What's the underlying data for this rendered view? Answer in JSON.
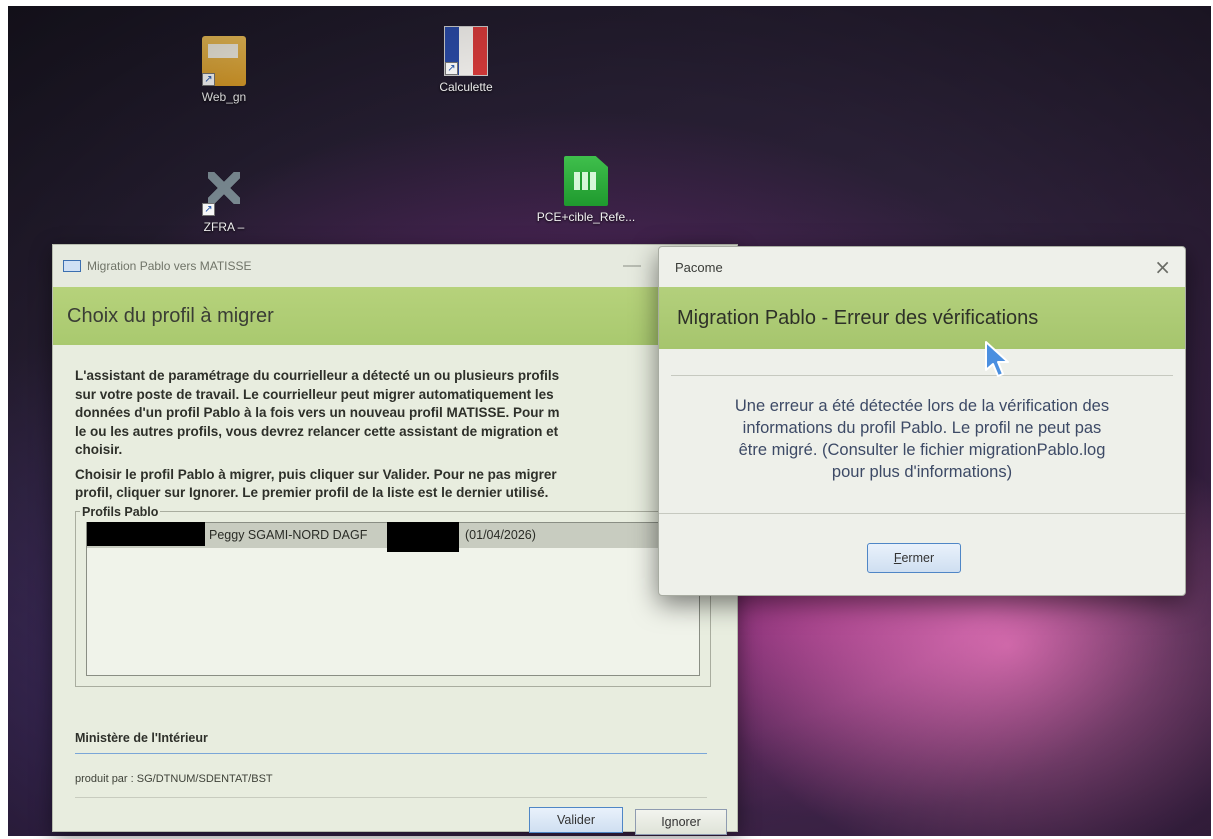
{
  "desktop": {
    "icons": [
      {
        "label": "Web_gn",
        "icon": "folder-icon"
      },
      {
        "label": "Calculette",
        "icon": "calculator-icon"
      },
      {
        "label": "ZFRA –",
        "icon": "network-icon"
      },
      {
        "label": "PCE+cible_Refe...",
        "icon": "spreadsheet-icon"
      }
    ]
  },
  "main_window": {
    "title": "Migration Pablo vers MATISSE",
    "heading": "Choix du profil à migrer",
    "paragraph1_lines": [
      "L'assistant de paramétrage du courrielleur a détecté un ou plusieurs profils",
      "sur votre poste de travail. Le courrielleur peut migrer automatiquement les",
      "données d'un profil Pablo à la fois vers un nouveau profil MATISSE. Pour m",
      "le ou les autres profils, vous devrez relancer cette assistant de migration et",
      "choisir."
    ],
    "paragraph2_lines": [
      "Choisir le profil Pablo à migrer, puis cliquer sur Valider. Pour ne pas migrer",
      "profil, cliquer sur Ignorer. Le premier profil de la liste est le dernier utilisé."
    ],
    "group_label": "Profils Pablo",
    "profiles": [
      {
        "name": "Peggy SGAMI-NORD DAGF",
        "date": "(01/04/2026)"
      }
    ],
    "ministry": "Ministère de l'Intérieur",
    "credit": "produit par : SG/DTNUM/SDENTAT/BST",
    "validate_label": "Valider",
    "ignore_label": "Ignorer"
  },
  "error_dialog": {
    "title": "Pacome",
    "heading": "Migration Pablo - Erreur des vérifications",
    "message_lines": [
      "Une erreur a été détectée lors de la vérification des",
      "informations du profil Pablo. Le profil ne peut pas",
      "être migré. (Consulter le fichier migrationPablo.log",
      "pour plus d'informations)"
    ],
    "close_label_first": "F",
    "close_label_rest": "ermer"
  },
  "colors": {
    "banner_green": "#b3d07c",
    "message_text": "#3d4a66",
    "cursor_blue": "#4a8fe0"
  }
}
